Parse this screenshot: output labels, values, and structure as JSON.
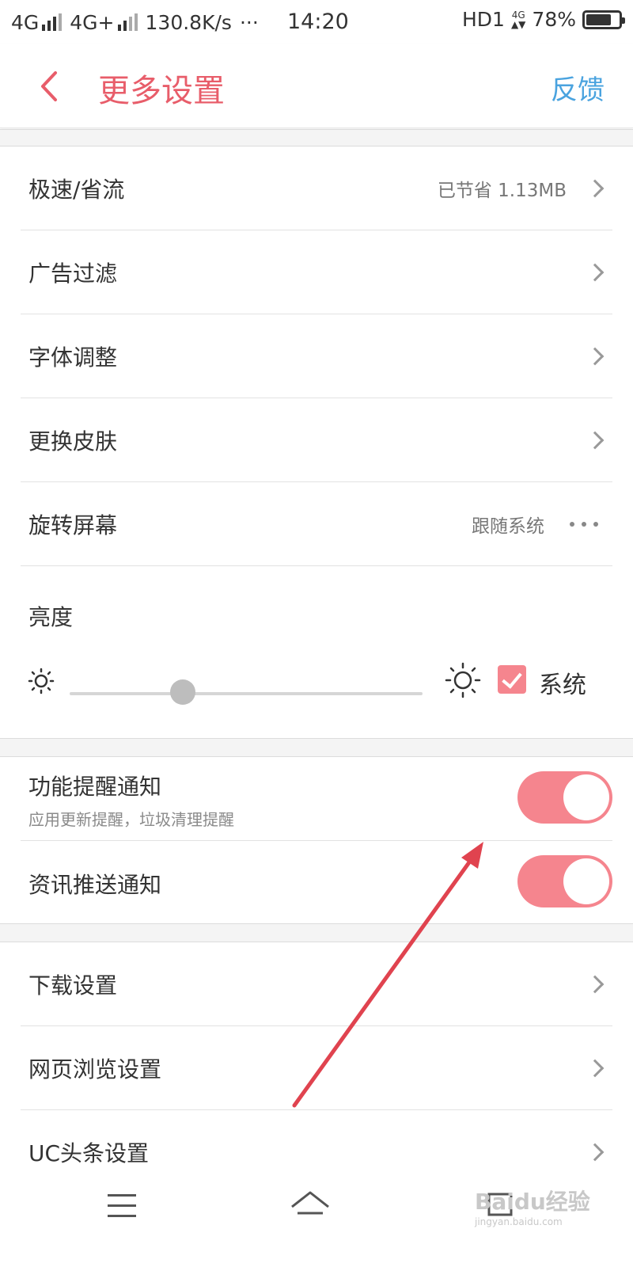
{
  "status_bar": {
    "network1": "4G",
    "network2": "4G+",
    "speed": "130.8K/s",
    "more": "···",
    "time": "14:20",
    "hd": "HD1",
    "net4g_small": "4G",
    "battery_percent": "78%",
    "battery_level": 0.78
  },
  "header": {
    "title": "更多设置",
    "feedback": "反馈"
  },
  "group1": [
    {
      "label": "极速/省流",
      "value": "已节省 1.13MB"
    },
    {
      "label": "广告过滤",
      "value": ""
    },
    {
      "label": "字体调整",
      "value": ""
    },
    {
      "label": "更换皮肤",
      "value": ""
    },
    {
      "label": "旋转屏幕",
      "value": "跟随系统"
    }
  ],
  "brightness": {
    "label": "亮度",
    "level": 0.32,
    "system_label": "系统",
    "system_checked": true
  },
  "notifications": [
    {
      "title": "功能提醒通知",
      "subtitle": "应用更新提醒，垃圾清理提醒",
      "on": true
    },
    {
      "title": "资讯推送通知",
      "subtitle": "",
      "on": true
    }
  ],
  "group3": [
    {
      "label": "下载设置"
    },
    {
      "label": "网页浏览设置"
    },
    {
      "label": "UC头条设置"
    }
  ],
  "watermark": {
    "text": "Baidu经验",
    "sub": "jingyan.baidu.com"
  },
  "colors": {
    "accent": "#e85d6a",
    "link": "#4aa3df",
    "toggle": "#f5858e",
    "arrow": "#e0434f"
  }
}
